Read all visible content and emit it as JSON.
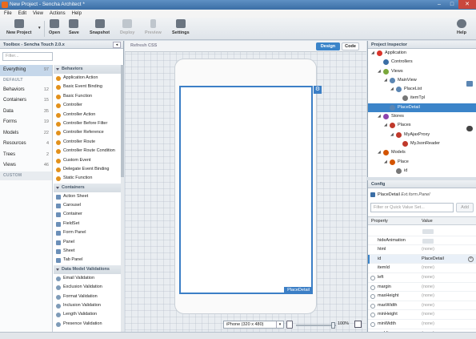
{
  "window": {
    "title": "New Project - Sencha Architect *",
    "controls": [
      "minimize",
      "maximize",
      "close"
    ]
  },
  "menu": [
    "File",
    "Edit",
    "View",
    "Actions",
    "Help"
  ],
  "toolbar": {
    "new_project": "New Project",
    "open": "Open",
    "save": "Save",
    "snapshot": "Snapshot",
    "deploy": "Deploy",
    "preview": "Preview",
    "settings": "Settings",
    "help": "Help"
  },
  "toolbox": {
    "title": "Toolbox - Sencha Touch 2.0.x",
    "filter_placeholder": "Filter...",
    "categories": [
      {
        "label": "Everything",
        "count": "97"
      },
      {
        "label": "DEFAULT",
        "count": ""
      },
      {
        "label": "Behaviors",
        "count": "12"
      },
      {
        "label": "Containers",
        "count": "15"
      },
      {
        "label": "Data",
        "count": "35"
      },
      {
        "label": "Forms",
        "count": "19"
      },
      {
        "label": "Models",
        "count": "22"
      },
      {
        "label": "Resources",
        "count": "4"
      },
      {
        "label": "Trees",
        "count": "2"
      },
      {
        "label": "Views",
        "count": "46"
      },
      {
        "label": "CUSTOM",
        "count": ""
      }
    ],
    "groups": [
      {
        "name": "Behaviors",
        "items": [
          "Application Action",
          "Basic Event Binding",
          "Basic Function",
          "Controller",
          "Controller Action",
          "Controller Before Filter",
          "Controller Reference",
          "Controller Route",
          "Controller Route Condition",
          "Custom Event",
          "Delegate Event Binding",
          "Static Function"
        ]
      },
      {
        "name": "Containers",
        "items": [
          "Action Sheet",
          "Carousel",
          "Container",
          "FieldSet",
          "Form Panel",
          "Panel",
          "Sheet",
          "Tab Panel"
        ]
      },
      {
        "name": "Data Model Validations",
        "items": [
          "Email Validation",
          "Exclusion Validation",
          "Format Validation",
          "Inclusion Validation",
          "Length Validation",
          "Presence Validation"
        ]
      }
    ]
  },
  "canvas": {
    "refresh_css": "Refresh CSS",
    "design": "Design",
    "code": "Code",
    "component_tag": "PlaceDetail",
    "device": "iPhone (320 x 480)",
    "zoom": "100%"
  },
  "inspector": {
    "title": "Project Inspector",
    "tree": [
      {
        "label": "Application",
        "level": 0,
        "expander": "◢",
        "color": "#d9342b"
      },
      {
        "label": "Controllers",
        "level": 1,
        "expander": "",
        "color": "#3b6ea5"
      },
      {
        "label": "Views",
        "level": 1,
        "expander": "◢",
        "color": "#7aa83b"
      },
      {
        "label": "MainView",
        "level": 2,
        "expander": "◢",
        "color": "#5b86b3"
      },
      {
        "label": "PlaceList",
        "level": 3,
        "expander": "◢",
        "color": "#5b86b3"
      },
      {
        "label": "itemTpl",
        "level": 4,
        "expander": "",
        "color": "#777777"
      },
      {
        "label": "PlaceDetail",
        "level": 2,
        "expander": "",
        "color": "#5b86b3",
        "selected": true
      },
      {
        "label": "Stores",
        "level": 1,
        "expander": "◢",
        "color": "#8e44ad"
      },
      {
        "label": "Places",
        "level": 2,
        "expander": "◢",
        "color": "#c0392b"
      },
      {
        "label": "MyAjaxProxy",
        "level": 3,
        "expander": "◢",
        "color": "#c0392b"
      },
      {
        "label": "MyJsonReader",
        "level": 4,
        "expander": "",
        "color": "#c0392b"
      },
      {
        "label": "Models",
        "level": 1,
        "expander": "◢",
        "color": "#d35400"
      },
      {
        "label": "Place",
        "level": 2,
        "expander": "◢",
        "color": "#d35400"
      },
      {
        "label": "id",
        "level": 3,
        "expander": "",
        "color": "#777777"
      }
    ]
  },
  "config": {
    "title": "Config",
    "component": "PlaceDetail",
    "component_type": "Ext.form.Panel",
    "filter_placeholder": "Filter or Quick Value Set...",
    "add": "Add",
    "col_property": "Property",
    "col_value": "Value",
    "properties": [
      {
        "name": "",
        "value": "",
        "toggle": true
      },
      {
        "name": "hideAnimation",
        "value": "",
        "toggle": true
      },
      {
        "name": "html",
        "value": "(none)"
      },
      {
        "name": "id",
        "value": "PlaceDetail",
        "set": true,
        "clear": "×"
      },
      {
        "name": "itemId",
        "value": "(none)"
      },
      {
        "name": "left",
        "value": "(none)",
        "minus": true
      },
      {
        "name": "margin",
        "value": "(none)",
        "minus": true
      },
      {
        "name": "maxHeight",
        "value": "(none)",
        "minus": true
      },
      {
        "name": "maxWidth",
        "value": "(none)",
        "minus": true
      },
      {
        "name": "minHeight",
        "value": "(none)",
        "minus": true
      },
      {
        "name": "minWidth",
        "value": "(none)",
        "minus": true
      },
      {
        "name": "padding",
        "value": "(none)",
        "minus": true
      }
    ]
  }
}
